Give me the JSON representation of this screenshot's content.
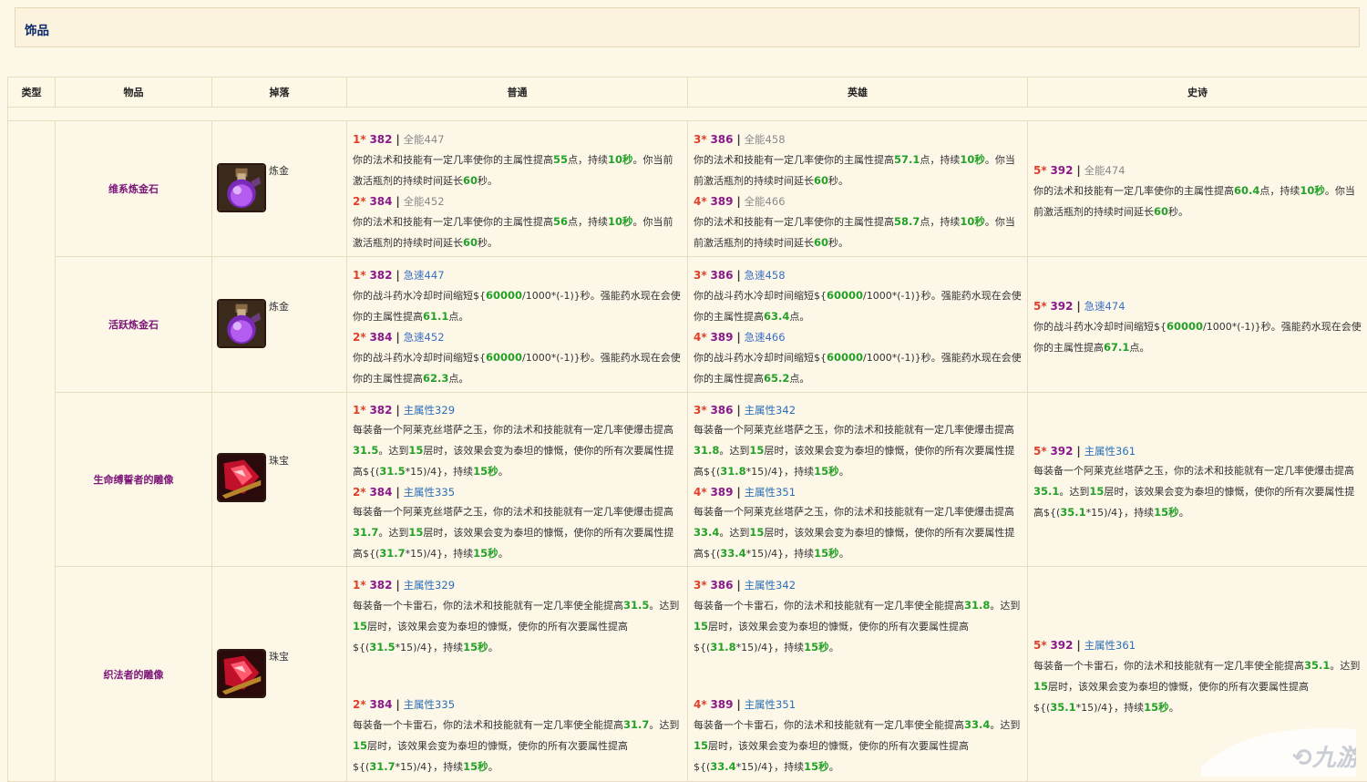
{
  "section_title": "饰品",
  "headers": {
    "type": "类型",
    "item": "物品",
    "drop": "掉落",
    "normal": "普通",
    "heroic": "英雄",
    "epic": "史诗"
  },
  "rows": [
    {
      "name": "维系炼金石",
      "drop": "炼金",
      "normal": [
        {
          "star": "1*",
          "level": "382",
          "stat": "全能447",
          "desc": [
            "你的法术和技能有一定几率使你的主属性提高",
            "55",
            "点，持续",
            "10秒",
            "。你当前激活瓶剂的持续时间延长",
            "60",
            "秒。"
          ]
        },
        {
          "star": "2*",
          "level": "384",
          "stat": "全能452",
          "desc": [
            "你的法术和技能有一定几率使你的主属性提高",
            "56",
            "点，持续",
            "10秒",
            "。你当前激活瓶剂的持续时间延长",
            "60",
            "秒。"
          ]
        }
      ],
      "heroic": [
        {
          "star": "3*",
          "level": "386",
          "stat": "全能458",
          "desc": [
            "你的法术和技能有一定几率使你的主属性提高",
            "57.1",
            "点，持续",
            "10秒",
            "。你当前激活瓶剂的持续时间延长",
            "60",
            "秒。"
          ]
        },
        {
          "star": "4*",
          "level": "389",
          "stat": "全能466",
          "desc": [
            "你的法术和技能有一定几率使你的主属性提高",
            "58.7",
            "点，持续",
            "10秒",
            "。你当前激活瓶剂的持续时间延长",
            "60",
            "秒。"
          ]
        }
      ],
      "epic": [
        {
          "star": "5*",
          "level": "392",
          "stat": "全能474",
          "desc": [
            "你的法术和技能有一定几率使你的主属性提高",
            "60.4",
            "点，持续",
            "10秒",
            "。你当前激活瓶剂的持续时间延长",
            "60",
            "秒。"
          ]
        }
      ]
    },
    {
      "name": "活跃炼金石",
      "drop": "炼金",
      "normal": [
        {
          "star": "1*",
          "level": "382",
          "stat": "急速447",
          "desc": [
            "你的战斗药水冷却时间缩短${",
            "60000",
            "/1000*(-1)}秒。强能药水现在会使你的主属性提高",
            "61.1",
            "点。"
          ]
        },
        {
          "star": "2*",
          "level": "384",
          "stat": "急速452",
          "desc": [
            "你的战斗药水冷却时间缩短${",
            "60000",
            "/1000*(-1)}秒。强能药水现在会使你的主属性提高",
            "62.3",
            "点。"
          ]
        }
      ],
      "heroic": [
        {
          "star": "3*",
          "level": "386",
          "stat": "急速458",
          "desc": [
            "你的战斗药水冷却时间缩短${",
            "60000",
            "/1000*(-1)}秒。强能药水现在会使你的主属性提高",
            "63.4",
            "点。"
          ]
        },
        {
          "star": "4*",
          "level": "389",
          "stat": "急速466",
          "desc": [
            "你的战斗药水冷却时间缩短${",
            "60000",
            "/1000*(-1)}秒。强能药水现在会使你的主属性提高",
            "65.2",
            "点。"
          ]
        }
      ],
      "epic": [
        {
          "star": "5*",
          "level": "392",
          "stat": "急速474",
          "desc": [
            "你的战斗药水冷却时间缩短${",
            "60000",
            "/1000*(-1)}秒。强能药水现在会使你的主属性提高",
            "67.1",
            "点。"
          ]
        }
      ]
    },
    {
      "name": "生命缚誓者的雕像",
      "drop": "珠宝",
      "normal": [
        {
          "star": "1*",
          "level": "382",
          "stat": "主属性329",
          "desc": [
            "每装备一个阿莱克丝塔萨之玉，你的法术和技能就有一定几率使爆击提高",
            "31.5",
            "。达到",
            "15",
            "层时，该效果会变为泰坦的慷慨，使你的所有次要属性提高${(",
            "31.5",
            "*15)/4}，持续",
            "15秒",
            "。"
          ]
        },
        {
          "star": "2*",
          "level": "384",
          "stat": "主属性335",
          "desc": [
            "每装备一个阿莱克丝塔萨之玉，你的法术和技能就有一定几率使爆击提高",
            "31.7",
            "。达到",
            "15",
            "层时，该效果会变为泰坦的慷慨，使你的所有次要属性提高${(",
            "31.7",
            "*15)/4}，持续",
            "15秒",
            "。"
          ]
        }
      ],
      "heroic": [
        {
          "star": "3*",
          "level": "386",
          "stat": "主属性342",
          "desc": [
            "每装备一个阿莱克丝塔萨之玉，你的法术和技能就有一定几率使爆击提高",
            "31.8",
            "。达到",
            "15",
            "层时，该效果会变为泰坦的慷慨，使你的所有次要属性提高${(",
            "31.8",
            "*15)/4}，持续",
            "15秒",
            "。"
          ]
        },
        {
          "star": "4*",
          "level": "389",
          "stat": "主属性351",
          "desc": [
            "每装备一个阿莱克丝塔萨之玉，你的法术和技能就有一定几率使爆击提高",
            "33.4",
            "。达到",
            "15",
            "层时，该效果会变为泰坦的慷慨，使你的所有次要属性提高${(",
            "33.4",
            "*15)/4}，持续",
            "15秒",
            "。"
          ]
        }
      ],
      "epic": [
        {
          "star": "5*",
          "level": "392",
          "stat": "主属性361",
          "desc": [
            "每装备一个阿莱克丝塔萨之玉，你的法术和技能就有一定几率使爆击提高",
            "35.1",
            "。达到",
            "15",
            "层时，该效果会变为泰坦的慷慨，使你的所有次要属性提高${(",
            "35.1",
            "*15)/4}，持续",
            "15秒",
            "。"
          ]
        }
      ]
    },
    {
      "name": "织法者的雕像",
      "drop": "珠宝",
      "normal": [
        {
          "star": "1*",
          "level": "382",
          "stat": "主属性329",
          "desc": [
            "每装备一个卡雷石，你的法术和技能就有一定几率使全能提高",
            "31.5",
            "。达到",
            "15",
            "层时，该效果会变为泰坦的慷慨，使你的所有次要属性提高${(",
            "31.5",
            "*15)/4}，持续",
            "15秒",
            "。"
          ]
        },
        {
          "star": "2*",
          "level": "384",
          "stat": "主属性335",
          "desc": [
            "每装备一个卡雷石，你的法术和技能就有一定几率使全能提高",
            "31.7",
            "。达到",
            "15",
            "层时，该效果会变为泰坦的慷慨，使你的所有次要属性提高${(",
            "31.7",
            "*15)/4}，持续",
            "15秒",
            "。"
          ]
        }
      ],
      "heroic": [
        {
          "star": "3*",
          "level": "386",
          "stat": "主属性342",
          "desc": [
            "每装备一个卡雷石，你的法术和技能就有一定几率使全能提高",
            "31.8",
            "。达到",
            "15",
            "层时，该效果会变为泰坦的慷慨，使你的所有次要属性提高${(",
            "31.8",
            "*15)/4}，持续",
            "15秒",
            "。"
          ]
        },
        {
          "star": "4*",
          "level": "389",
          "stat": "主属性351",
          "desc": [
            "每装备一个卡雷石，你的法术和技能就有一定几率使全能提高",
            "33.4",
            "。达到",
            "15",
            "层时，该效果会变为泰坦的慷慨，使你的所有次要属性提高${(",
            "33.4",
            "*15)/4}，持续",
            "15秒",
            "。"
          ]
        }
      ],
      "epic": [
        {
          "star": "5*",
          "level": "392",
          "stat": "主属性361",
          "desc": [
            "每装备一个卡雷石，你的法术和技能就有一定几率使全能提高",
            "35.1",
            "。达到",
            "15",
            "层时，该效果会变为泰坦的慷慨，使你的所有次要属性提高${(",
            "35.1",
            "*15)/4}，持续",
            "15秒",
            "。"
          ]
        }
      ]
    }
  ],
  "icons": [
    "potion-icon",
    "potion-icon",
    "gem-figurine-icon",
    "gem-figurine-icon"
  ],
  "colors": {
    "highlight_green": "#23a026",
    "star_red": "#e0402a",
    "level_purple": "#8a1a8a",
    "haste_blue": "#3b6fc2",
    "item_name": "#7c1478"
  }
}
